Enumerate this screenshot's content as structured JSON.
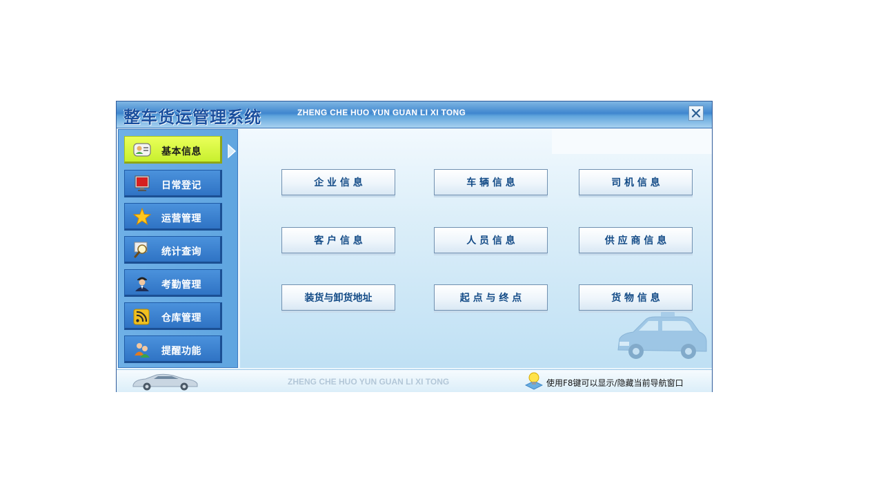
{
  "window": {
    "title_cn": "整车货运管理系统",
    "title_en": "ZHENG CHE HUO YUN GUAN LI XI TONG",
    "close_icon": "close-icon"
  },
  "sidebar": {
    "items": [
      {
        "label": "基本信息",
        "icon": "contact-card-icon",
        "active": true
      },
      {
        "label": "日常登记",
        "icon": "monitor-icon",
        "active": false
      },
      {
        "label": "运营管理",
        "icon": "star-icon",
        "active": false
      },
      {
        "label": "统计查询",
        "icon": "magnifier-icon",
        "active": false
      },
      {
        "label": "考勤管理",
        "icon": "staff-person-icon",
        "active": false
      },
      {
        "label": "仓库管理",
        "icon": "rss-feed-icon",
        "active": false
      },
      {
        "label": "提醒功能",
        "icon": "users-group-icon",
        "active": false
      }
    ]
  },
  "main": {
    "buttons": [
      {
        "label": "企 业 信 息"
      },
      {
        "label": "车 辆 信 息"
      },
      {
        "label": "司 机 信 息"
      },
      {
        "label": "客 户 信 息"
      },
      {
        "label": "人 员 信 息"
      },
      {
        "label": "供 应 商 信 息"
      },
      {
        "label": "装货与卸货地址"
      },
      {
        "label": "起 点 与 终 点"
      },
      {
        "label": "货 物 信 息"
      }
    ]
  },
  "statusbar": {
    "brand_en": "ZHENG CHE HUO YUN GUAN LI XI TONG",
    "tip": "使用F8键可以显示/隐藏当前导航窗口"
  },
  "colors": {
    "accent": "#3f86cf",
    "active_nav": "#d8f83c",
    "button_text": "#124a86"
  }
}
